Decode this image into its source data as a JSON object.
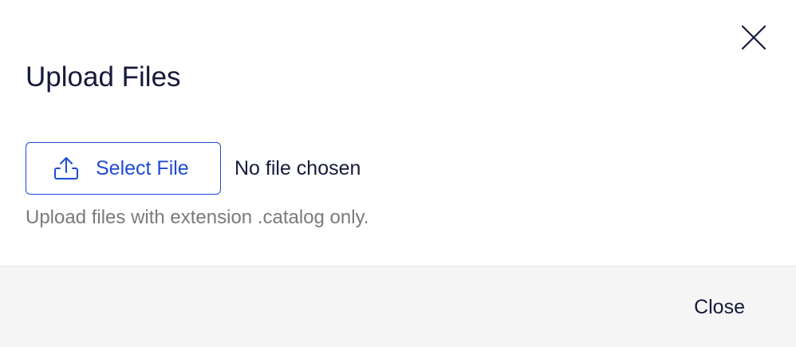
{
  "dialog": {
    "title": "Upload Files",
    "select_button_label": "Select File",
    "file_status": "No file chosen",
    "hint": "Upload files with extension .catalog only.",
    "footer_close_label": "Close"
  },
  "icons": {
    "close": "close-icon",
    "upload": "upload-icon"
  },
  "colors": {
    "accent": "#1f4ad6",
    "title_text": "#141a3a",
    "hint_text": "#7a7a7a",
    "footer_bg": "#f5f5f5"
  }
}
